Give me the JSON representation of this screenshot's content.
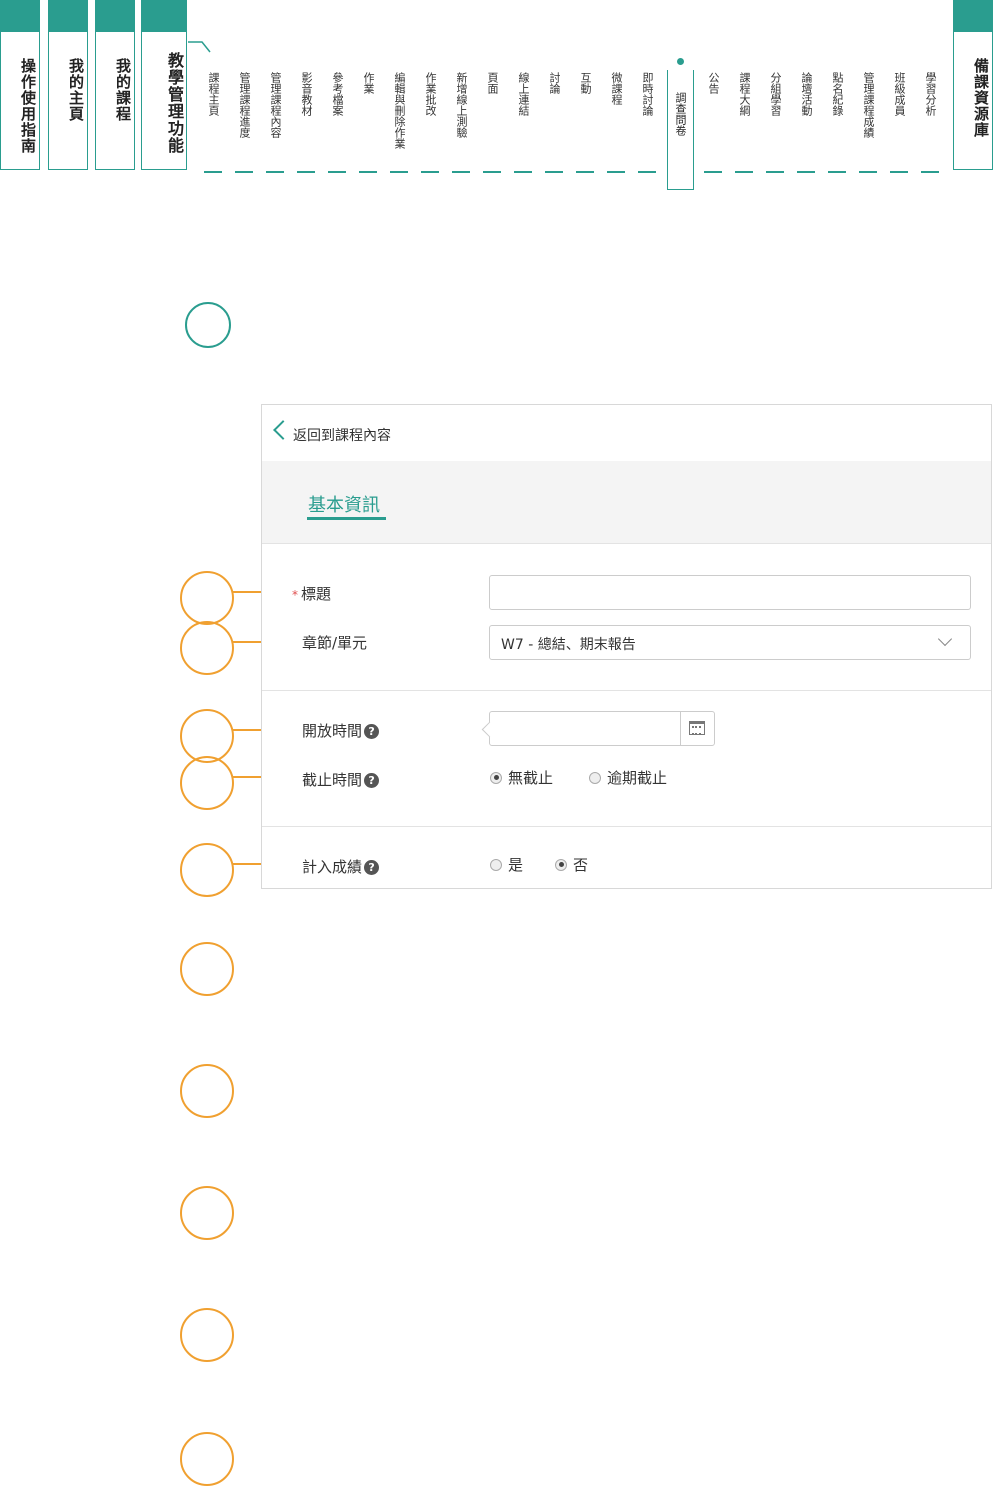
{
  "main_tabs": [
    {
      "label": "操作使用指南"
    },
    {
      "label": "我的主頁"
    },
    {
      "label": "我的課程"
    },
    {
      "label": "教學管理功能"
    },
    {
      "label": "備課資源庫"
    }
  ],
  "sub_tabs": [
    {
      "label": "課程主頁"
    },
    {
      "label": "管理課程進度"
    },
    {
      "label": "管理課程內容"
    },
    {
      "label": "影音教材"
    },
    {
      "label": "參考檔案"
    },
    {
      "label": "作業"
    },
    {
      "label": "編輯與刪除作業"
    },
    {
      "label": "作業批改"
    },
    {
      "label": "新增線上測驗"
    },
    {
      "label": "頁面"
    },
    {
      "label": "線上連結"
    },
    {
      "label": "討論"
    },
    {
      "label": "互動"
    },
    {
      "label": "微課程"
    },
    {
      "label": "即時討論"
    },
    {
      "label": "調查問卷"
    },
    {
      "label": "公告"
    },
    {
      "label": "課程大綱"
    },
    {
      "label": "分組學習"
    },
    {
      "label": "論壇活動"
    },
    {
      "label": "點名紀錄"
    },
    {
      "label": "管理課程成績"
    },
    {
      "label": "班級成員"
    },
    {
      "label": "學習分析"
    }
  ],
  "active_sub_tab": "調查問卷",
  "form": {
    "back_link": "返回到課程內容",
    "tab": "基本資訊",
    "title_label": "標題",
    "title_value": "",
    "chapter_label": "章節/單元",
    "chapter_value": "W7 - 總結、期末報告",
    "open_time_label": "開放時間",
    "open_time_value": "",
    "deadline_label": "截止時間",
    "deadline_options": [
      "無截止",
      "逾期截止"
    ],
    "deadline_selected": "無截止",
    "grade_label": "計入成績",
    "grade_options": [
      "是",
      "否"
    ],
    "grade_selected": "否",
    "help_glyph": "?",
    "required_mark": "*"
  },
  "colors": {
    "accent": "#2a9d8f",
    "callout": "#f0a030"
  },
  "icons": [
    "chevron-left-icon",
    "chevron-down-icon",
    "calendar-icon",
    "help-icon"
  ]
}
